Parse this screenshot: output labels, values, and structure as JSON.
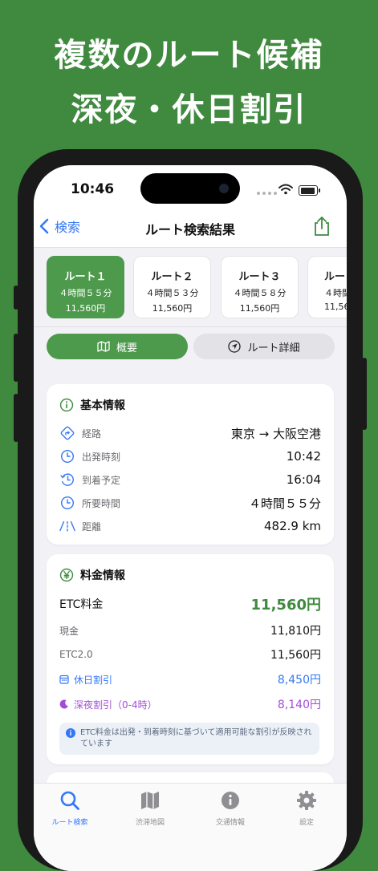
{
  "headline": {
    "line1": "複数のルート候補",
    "line2": "深夜・休日割引"
  },
  "status_bar": {
    "time": "10:46"
  },
  "nav": {
    "back_label": "検索",
    "title": "ルート検索結果"
  },
  "routes": [
    {
      "name": "ルート１",
      "duration": "４時間５５分",
      "price": "11,560円",
      "active": true
    },
    {
      "name": "ルート２",
      "duration": "４時間５３分",
      "price": "11,560円",
      "active": false
    },
    {
      "name": "ルート３",
      "duration": "４時間５８分",
      "price": "11,560円",
      "active": false
    },
    {
      "name": "ルー",
      "duration": "４時間",
      "price": "11,56",
      "active": false
    }
  ],
  "segments": {
    "overview": "概要",
    "detail": "ルート詳細"
  },
  "basic_info": {
    "title": "基本情報",
    "rows": [
      {
        "label": "経路",
        "value": "東京 → 大阪空港"
      },
      {
        "label": "出発時刻",
        "value": "10:42"
      },
      {
        "label": "到着予定",
        "value": "16:04"
      },
      {
        "label": "所要時間",
        "value": "４時間５５分"
      },
      {
        "label": "距離",
        "value": "482.9 km"
      }
    ]
  },
  "fee_info": {
    "title": "料金情報",
    "etc": {
      "label": "ETC料金",
      "value": "11,560円"
    },
    "cash": {
      "label": "現金",
      "value": "11,810円"
    },
    "etc2": {
      "label": "ETC2.0",
      "value": "11,560円"
    },
    "holiday": {
      "label": "休日割引",
      "value": "8,450円"
    },
    "night": {
      "label": "深夜割引（0-4時）",
      "value": "8,140円"
    },
    "note": "ETC料金は出発・到着時刻に基づいて適用可能な割引が反映されています"
  },
  "tabs": [
    {
      "label": "ルート検索",
      "icon": "search-icon"
    },
    {
      "label": "渋滞地図",
      "icon": "map-icon"
    },
    {
      "label": "交通情報",
      "icon": "info-icon"
    },
    {
      "label": "設定",
      "icon": "gear-icon"
    }
  ],
  "colors": {
    "background": "#3f8a3f",
    "accent_green": "#4d9a4d",
    "link_blue": "#3478f6",
    "night_purple": "#a24dd6"
  }
}
